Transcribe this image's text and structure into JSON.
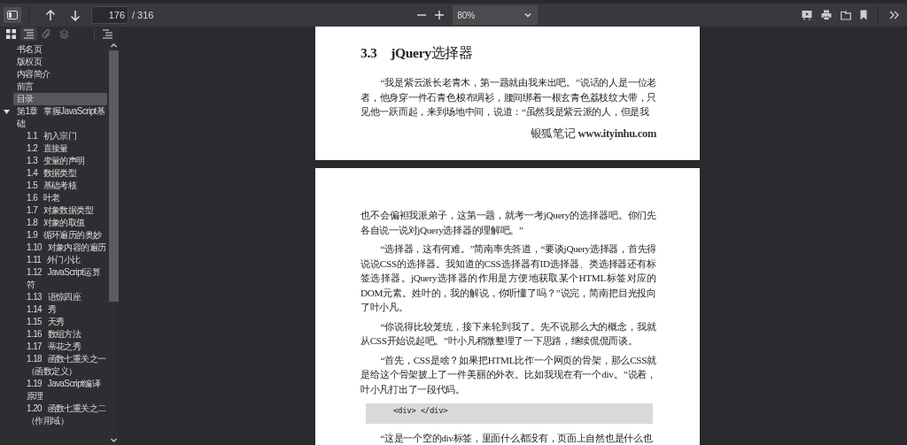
{
  "toolbar": {
    "sidebar_open": true,
    "page_number": "176",
    "page_count": "/ 316",
    "zoom": "80%"
  },
  "sidebar": {
    "view_buttons": [
      {
        "kind": "thumbnails",
        "selected": false
      },
      {
        "kind": "outline",
        "selected": true
      },
      {
        "kind": "attachments",
        "selected": false
      },
      {
        "kind": "layers",
        "selected": false
      }
    ],
    "outline": [
      {
        "title": "书名页",
        "selected": false
      },
      {
        "title": "版权页",
        "selected": false
      },
      {
        "title": "内容简介",
        "selected": false
      },
      {
        "title": "前言",
        "selected": false
      },
      {
        "title": "目录",
        "selected": true
      },
      {
        "title": "第1章   掌握JavaScript基础",
        "selected": false,
        "expanded": true,
        "children": [
          {
            "title": "1.1   初入宗门",
            "selected": false
          },
          {
            "title": "1.2   直接量",
            "selected": false
          },
          {
            "title": "1.3   变量的声明",
            "selected": false
          },
          {
            "title": "1.4   数据类型",
            "selected": false
          },
          {
            "title": "1.5   基础考核",
            "selected": false
          },
          {
            "title": "1.6   叶老",
            "selected": false
          },
          {
            "title": "1.7   对象数据类型",
            "selected": false
          },
          {
            "title": "1.8   对象的取值",
            "selected": false
          },
          {
            "title": "1.9   循环遍历的奥妙",
            "selected": false
          },
          {
            "title": "1.10   对象内容的遍历",
            "selected": false
          },
          {
            "title": "1.11   外门小比",
            "selected": false
          },
          {
            "title": "1.12   JavaScript运算符",
            "selected": false
          },
          {
            "title": "1.13   语惊四座",
            "selected": false
          },
          {
            "title": "1.14   秀",
            "selected": false
          },
          {
            "title": "1.15   天秀",
            "selected": false
          },
          {
            "title": "1.16   数组方法",
            "selected": false
          },
          {
            "title": "1.17   蒂花之秀",
            "selected": false
          },
          {
            "title": "1.18   函数七重关之一（函数定义）",
            "selected": false
          },
          {
            "title": "1.19   JavaScript编译原理",
            "selected": false
          },
          {
            "title": "1.20   函数七重关之二（作用域）",
            "selected": false
          }
        ]
      }
    ]
  },
  "pages": [
    {
      "blocks": [
        {
          "kind": "heading",
          "text": "**3.3　jQuery**选择器"
        },
        {
          "kind": "paragraph",
          "text": "“我是紫云派长老青木，第一题就由我来出吧。”说话的人是一位老者，他身穿一件石青色梭布绸衫，腰间绑着一根玄青色荔枝纹大带，只见他一跃而起，来到场地中间，说道：“虽然我是紫云派的人，但是我"
        },
        {
          "kind": "footer",
          "text": "银狐笔记 **www.ityinhu.com**"
        }
      ]
    },
    {
      "blocks": [
        {
          "kind": "continuation",
          "text": "也不会偏袒我派弟子，这第一题，就考一考jQuery的选择器吧。你们先各自说一说对jQuery选择器的理解吧。”"
        },
        {
          "kind": "paragraph",
          "text": "“选择器，这有何难。”简南率先答道，“要谈jQuery选择器，首先得说说CSS的选择器。我知道的CSS选择器有ID选择器、类选择器还有标签选择器。jQuery选择器的作用是方便地获取某个HTML标签对应的DOM元素。姓叶的，我的解说，你听懂了吗？”说完，简南把目光投向了叶小凡。"
        },
        {
          "kind": "paragraph",
          "text": "“你说得比较笼统，接下来轮到我了。先不说那么大的概念，我就从CSS开始说起吧。”叶小凡稍微整理了一下思路，继续侃侃而谈。"
        },
        {
          "kind": "paragraph",
          "text": "“首先，CSS是啥？如果把HTML比作一个网页的骨架，那么CSS就是给这个骨架披上了一件美丽的外衣。比如我现在有一个div。”说着，叶小凡打出了一段代码。"
        },
        {
          "kind": "code",
          "text": "<div> </div>"
        },
        {
          "kind": "paragraph",
          "text": "“这是一个空的div标签，里面什么都没有，页面上自然也是什么也"
        }
      ]
    }
  ]
}
